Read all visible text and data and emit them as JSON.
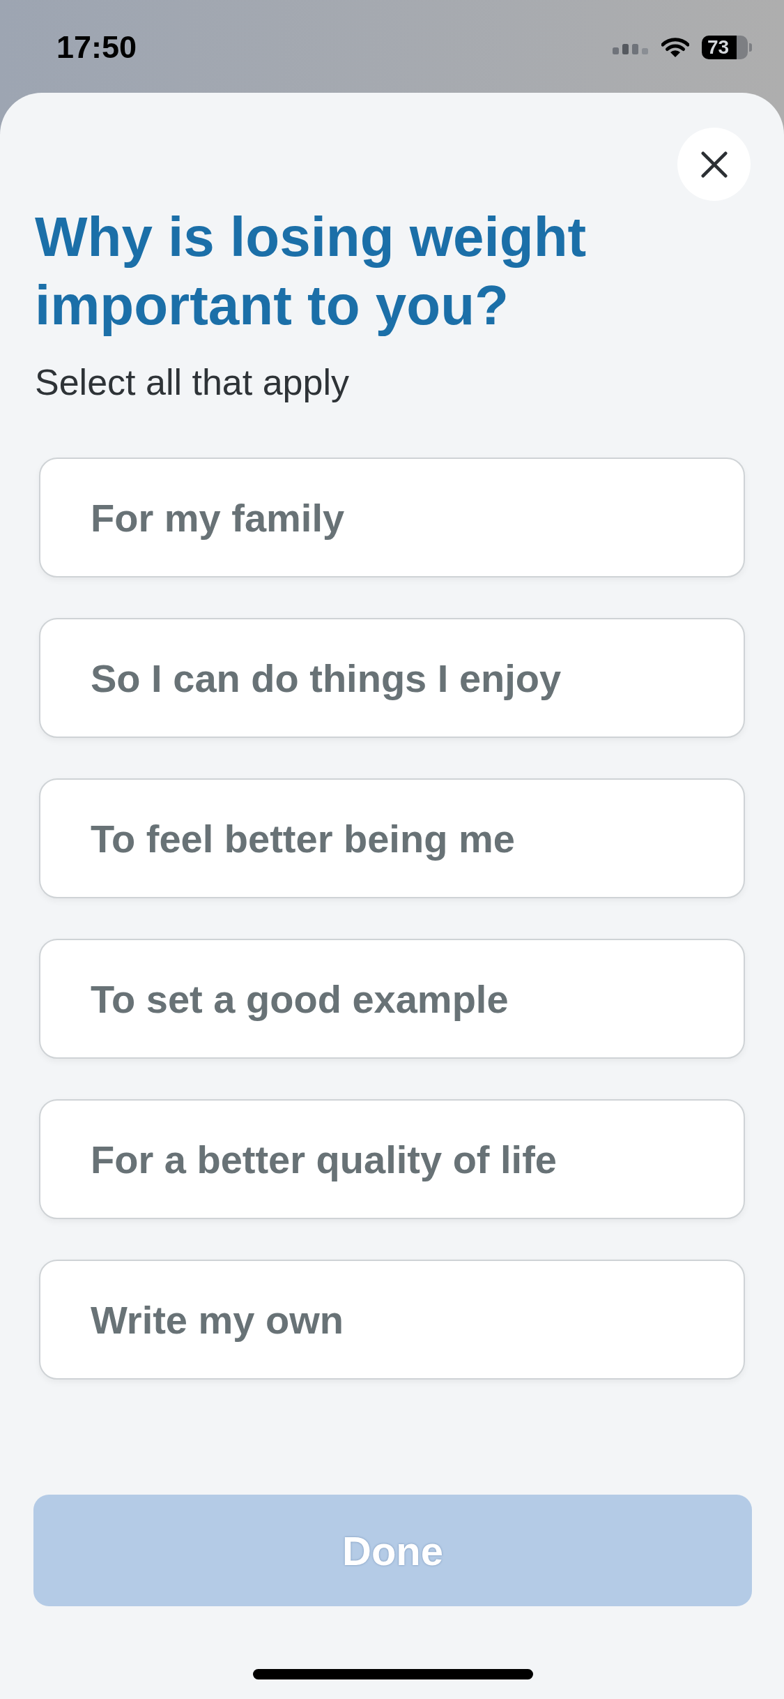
{
  "status_bar": {
    "time": "17:50",
    "battery": "73"
  },
  "title": "Why is losing weight important to you?",
  "subtitle": "Select all that apply",
  "options": [
    {
      "label": "For my family",
      "selected": false
    },
    {
      "label": "So I can do things I enjoy",
      "selected": false
    },
    {
      "label": "To feel better being me",
      "selected": false
    },
    {
      "label": "To set a good example",
      "selected": false
    },
    {
      "label": "For a better quality of life",
      "selected": false
    },
    {
      "label": "Write my own",
      "selected": false
    }
  ],
  "done_button": {
    "label": "Done",
    "disabled": true
  }
}
